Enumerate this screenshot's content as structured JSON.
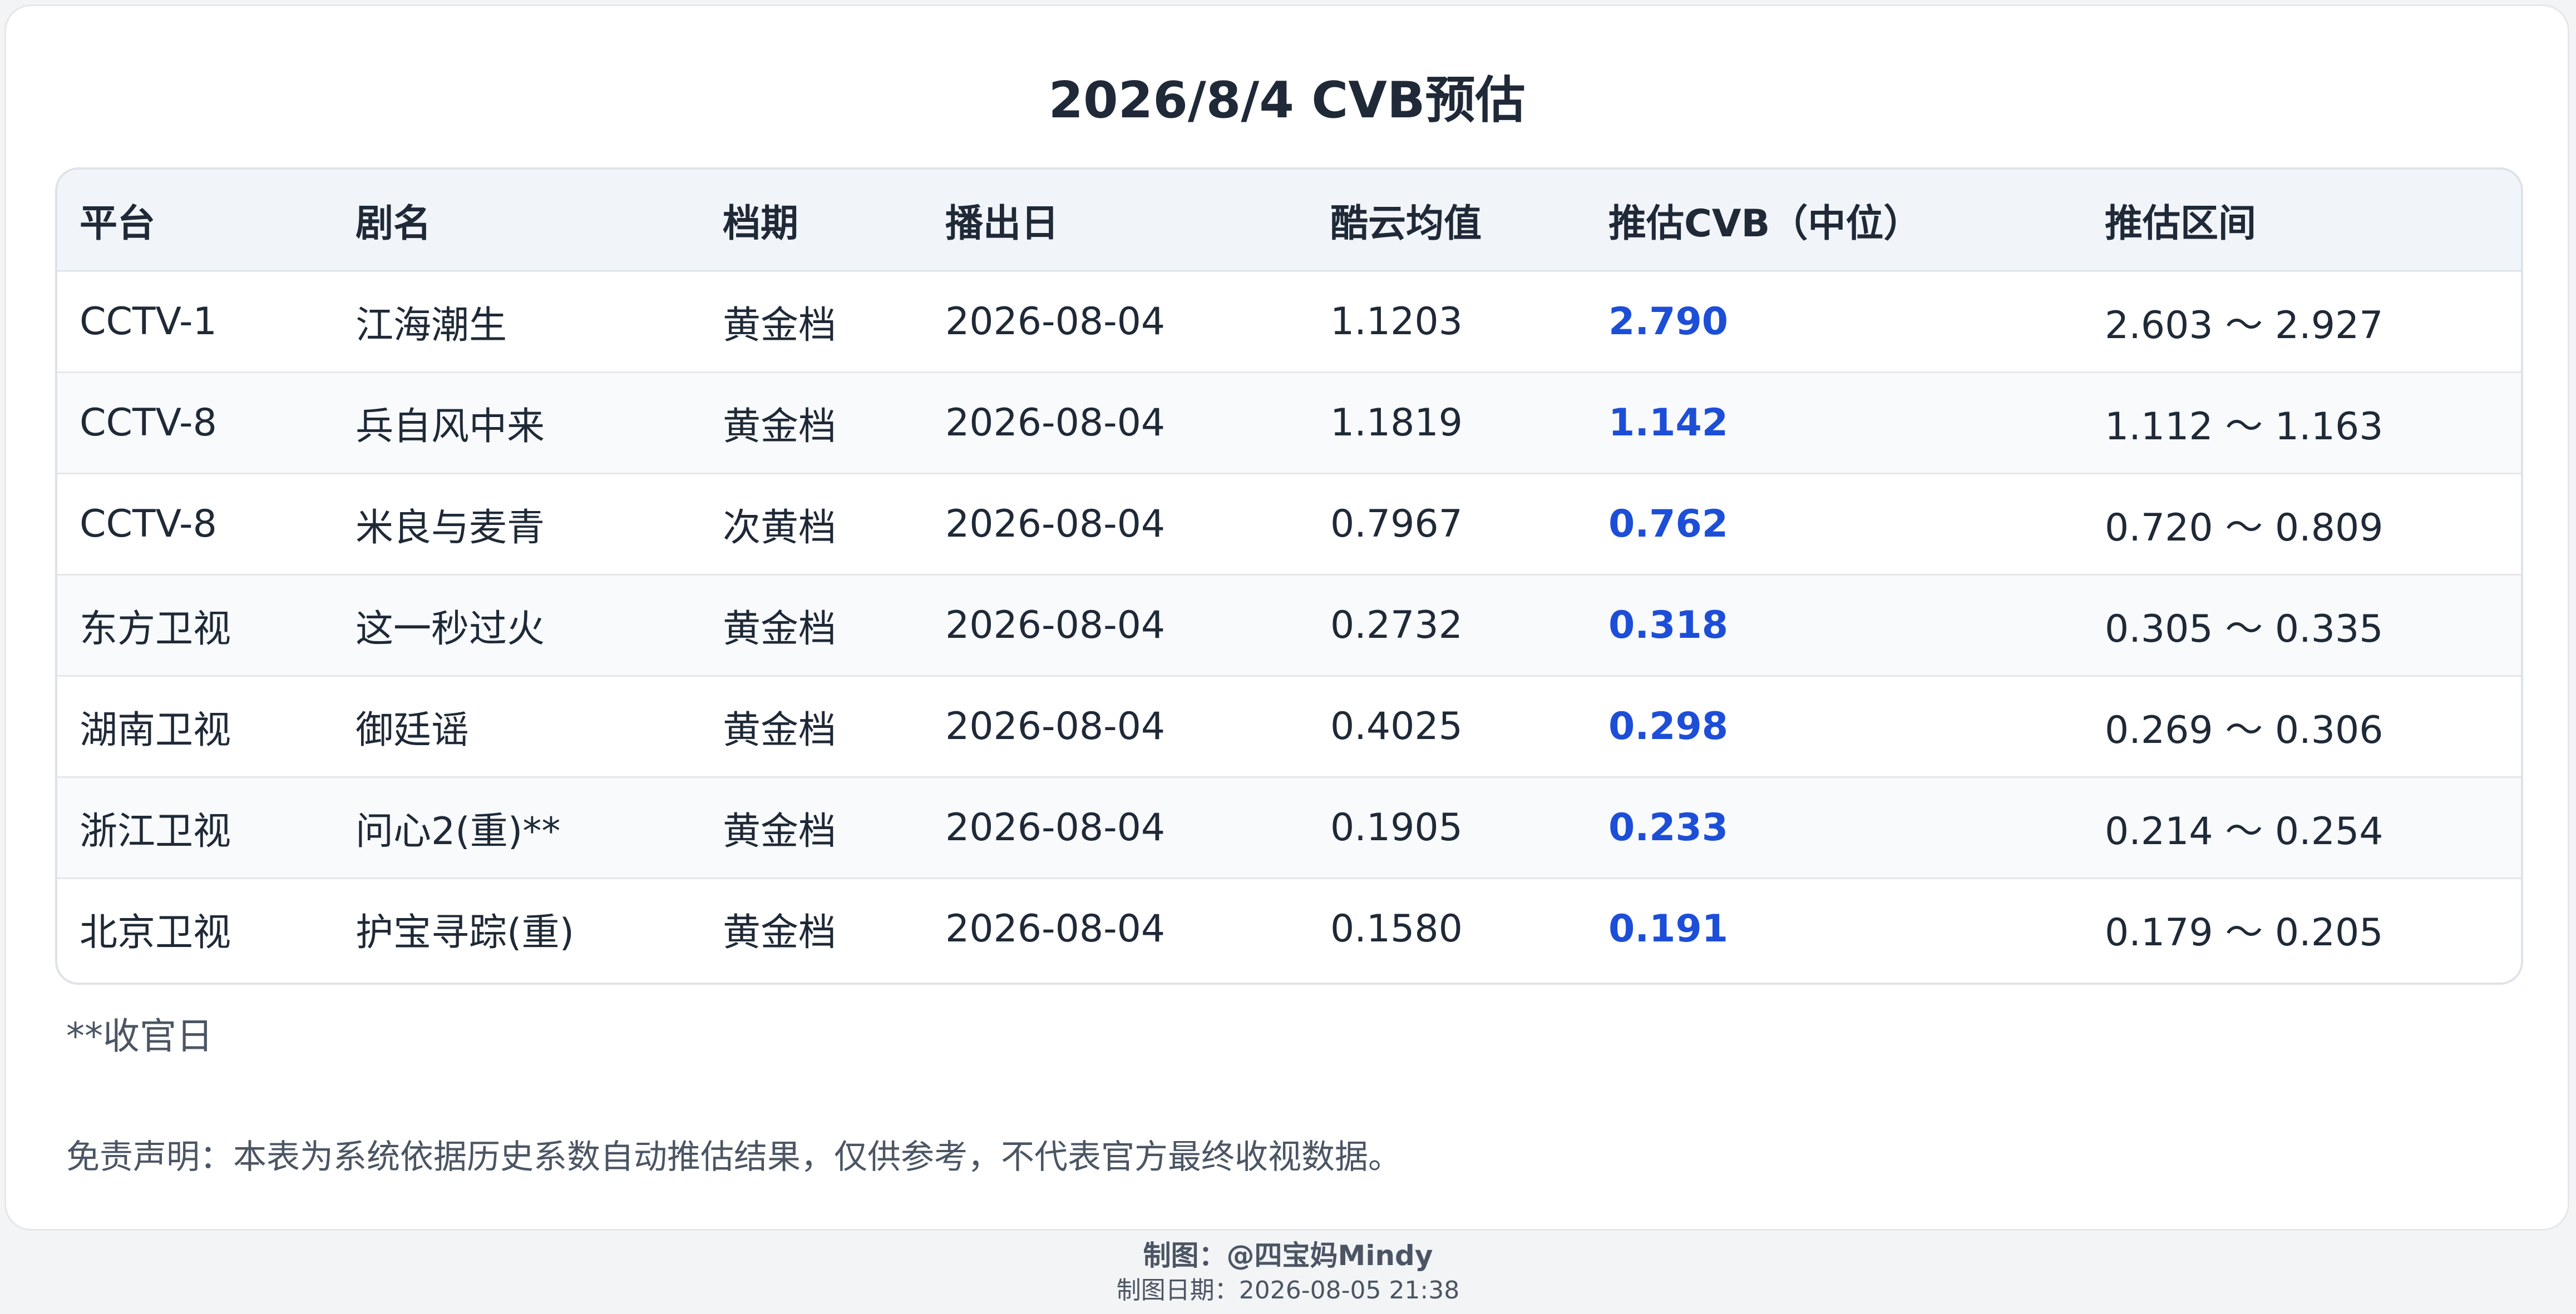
{
  "title": "2026/8/4 CVB预估",
  "table": {
    "headers": [
      "平台",
      "剧名",
      "档期",
      "播出日",
      "酷云均值",
      "推估CVB（中位）",
      "推估区间"
    ],
    "rows": [
      [
        "CCTV-1",
        "江海潮生",
        "黄金档",
        "2026-08-04",
        "1.1203",
        "2.790",
        "2.603 ～ 2.927"
      ],
      [
        "CCTV-8",
        "兵自风中来",
        "黄金档",
        "2026-08-04",
        "1.1819",
        "1.142",
        "1.112 ～ 1.163"
      ],
      [
        "CCTV-8",
        "米良与麦青",
        "次黄档",
        "2026-08-04",
        "0.7967",
        "0.762",
        "0.720 ～ 0.809"
      ],
      [
        "东方卫视",
        "这一秒过火",
        "黄金档",
        "2026-08-04",
        "0.2732",
        "0.318",
        "0.305 ～ 0.335"
      ],
      [
        "湖南卫视",
        "御廷谣",
        "黄金档",
        "2026-08-04",
        "0.4025",
        "0.298",
        "0.269 ～ 0.306"
      ],
      [
        "浙江卫视",
        "问心2(重)**",
        "黄金档",
        "2026-08-04",
        "0.1905",
        "0.233",
        "0.214 ～ 0.254"
      ],
      [
        "北京卫视",
        "护宝寻踪(重)",
        "黄金档",
        "2026-08-04",
        "0.1580",
        "0.191",
        "0.179 ～ 0.205"
      ]
    ]
  },
  "note": "**收官日",
  "disclaimer": "免责声明：本表为系统依据历史系数自动推估结果，仅供参考，不代表官方最终收视数据。",
  "footer": {
    "author": "制图：@四宝妈Mindy",
    "date": "制图日期：2026-08-05 21:38"
  },
  "colors": {
    "cvb_value": "#1d4ed8",
    "header_bg": "#f1f5f9",
    "border": "#dde3ea"
  }
}
